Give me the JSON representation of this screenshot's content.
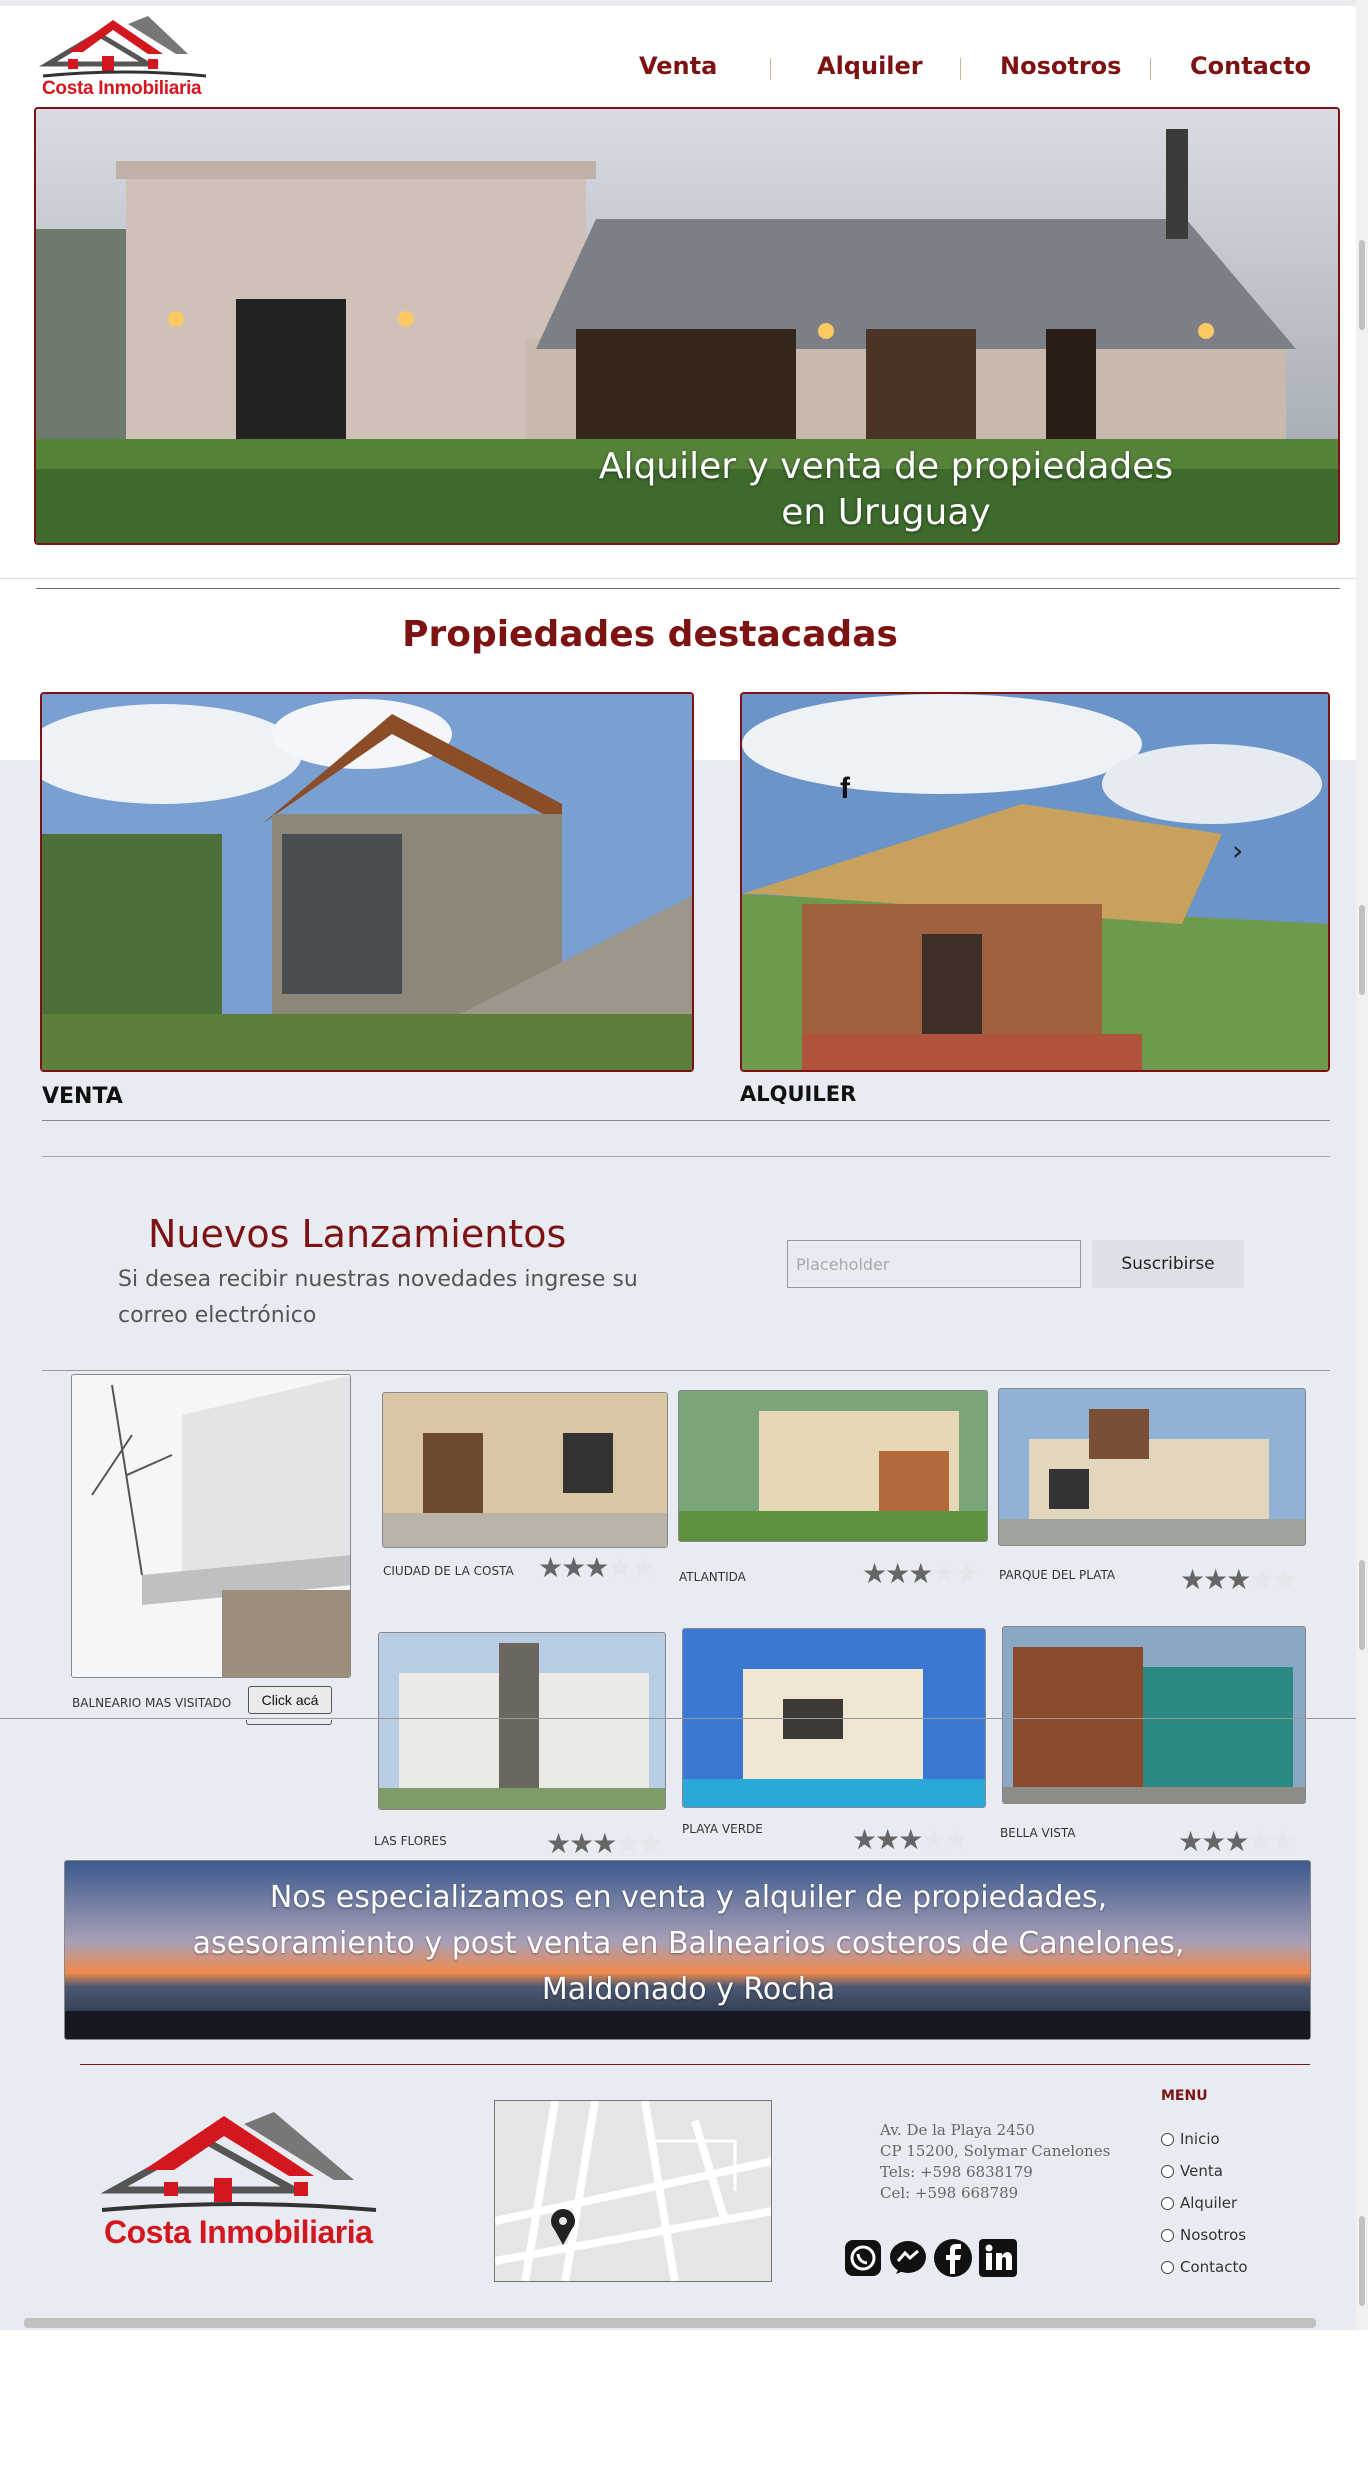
{
  "brand": {
    "logo_text_main": "Costa",
    "logo_text_accent": "Inmobiliaria",
    "primary_color": "#7d1212",
    "logo_red": "#d3171e"
  },
  "nav": {
    "items": [
      "Venta",
      "Alquiler",
      "Nosotros",
      "Contacto"
    ]
  },
  "hero": {
    "line1": "Alquiler y venta de propiedades",
    "line2": "en Uruguay"
  },
  "featured": {
    "title": "Propiedades destacadas",
    "cards": [
      {
        "label": "VENTA"
      },
      {
        "label": "ALQUILER"
      }
    ],
    "facebook_icon": "facebook-icon",
    "next_icon": "chevron-right-icon"
  },
  "newsletter": {
    "title": "Nuevos Lanzamientos",
    "subtitle_line1": "Si desea recibir nuestras novedades ingrese su",
    "subtitle_line2": "correo electrónico",
    "email_placeholder": "Placeholder",
    "button_label": "Suscribirse"
  },
  "gallery": {
    "feature": {
      "caption": "BALNEARIO MAS VISITADO",
      "button": "Click acá"
    },
    "items": [
      {
        "caption": "CIUDAD DE LA COSTA",
        "rating": 3,
        "max": 5
      },
      {
        "caption": "ATLANTIDA",
        "rating": 3,
        "max": 5
      },
      {
        "caption": "PARQUE DEL PLATA",
        "rating": 3,
        "max": 5
      },
      {
        "caption": "LAS FLORES",
        "rating": 3,
        "max": 5
      },
      {
        "caption": "PLAYA VERDE",
        "rating": 3,
        "max": 5
      },
      {
        "caption": "BELLA VISTA",
        "rating": 3,
        "max": 5
      }
    ]
  },
  "banner": {
    "line1": "Nos especializamos en venta y alquiler de propiedades,",
    "line2": "asesoramiento y post venta en Balnearios costeros de Canelones,",
    "line3": "Maldonado y Rocha"
  },
  "footer": {
    "address_line1": "Av. De la Playa 2450",
    "address_line2": "CP 15200, Solymar Canelones",
    "tel": "Tels: +598 6838179",
    "cel": "Cel: +598 668789",
    "menu_title": "MENU",
    "menu_items": [
      "Inicio",
      "Venta",
      "Alquiler",
      "Nosotros",
      "Contacto"
    ],
    "social_icons": [
      "whatsapp-icon",
      "messenger-icon",
      "facebook-icon",
      "linkedin-icon"
    ]
  }
}
